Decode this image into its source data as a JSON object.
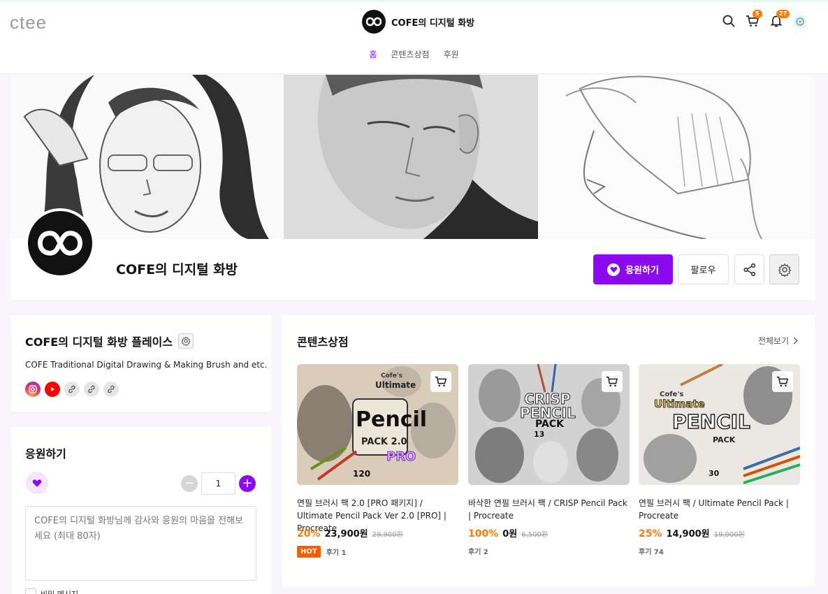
{
  "header": {
    "logo": "ctee",
    "brand_name": "COFE의 디지털 화방",
    "nav": [
      {
        "label": "홈",
        "active": true
      },
      {
        "label": "콘텐츠상점",
        "active": false
      },
      {
        "label": "후원",
        "active": false
      }
    ],
    "icons": [
      "search-icon",
      "cart-icon",
      "bell-icon",
      "avatar"
    ],
    "cart_count": "5",
    "notification_count": "27",
    "accent_color": "#8b0af0"
  },
  "profile": {
    "name": "COFE의 디지털 화방",
    "support_button": "응원하기",
    "follow_button": "팔로우"
  },
  "place": {
    "title": "COFE의 디지털 화방 플레이스",
    "description": "COFE Traditional Digital Drawing & Making Brush and etc.",
    "socials": [
      "instagram-icon",
      "youtube-icon",
      "link-icon",
      "link-icon",
      "link-icon"
    ]
  },
  "support": {
    "title": "응원하기",
    "quantity": "1",
    "message_placeholder": "COFE의 디지털 화방님께 감사와 응원의 마음을 전해보세요 (최대 80자)",
    "secret_label": "비밀 메시지"
  },
  "store": {
    "title": "콘텐츠상점",
    "view_all": "전체보기",
    "products": [
      {
        "title": "연필 브러시 팩 2.0 [PRO 패키지] / Ultimate Pencil Pack Ver 2.0 [PRO] | Procreate",
        "discount": "20%",
        "price": "23,900원",
        "original_price": "29,900원",
        "hot": "HOT",
        "reviews": "후기 1",
        "thumb": {
          "line1": "Cofe's",
          "line2": "Ultimate",
          "line3": "Pencil",
          "line4": "PACK 2.0",
          "line5": "PRO",
          "line6": "120"
        }
      },
      {
        "title": "바삭한 연필 브러시 팩 / CRISP Pencil Pack | Procreate",
        "discount": "100%",
        "price": "0원",
        "original_price": "6,500원",
        "hot": "",
        "reviews": "후기 2",
        "thumb": {
          "line1": "CRISP",
          "line2": "PENCIL",
          "line3": "PACK",
          "line4": "13"
        }
      },
      {
        "title": "연필 브러시 팩 / Ultimate Pencil Pack | Procreate",
        "discount": "25%",
        "price": "14,900원",
        "original_price": "19,900원",
        "hot": "",
        "reviews": "후기 74",
        "thumb": {
          "line1": "Cofe's",
          "line2": "Ultimate",
          "line3": "PENCIL",
          "line4": "PACK",
          "line5": "30"
        }
      }
    ]
  }
}
